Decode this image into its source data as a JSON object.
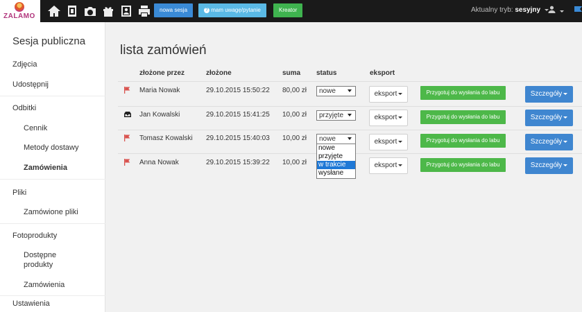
{
  "brand": {
    "logo_text": "ZALAMO"
  },
  "toolbar": {
    "icons": [
      "home-icon",
      "album-icon",
      "camera-icon",
      "gift-icon",
      "portrait-icon",
      "print-icon"
    ],
    "new_session": "nowa sesja",
    "question": "mam uwagę/pytanie",
    "creator": "Kreator",
    "mode_label": "Aktualny tryb:",
    "mode_value": "sesyjny"
  },
  "colors": {
    "topbar": "#1a1a1a",
    "green": "#4db849",
    "blue": "#3f86d0",
    "flag": "#d9534f",
    "highlight": "#1e78d6"
  },
  "sidebar": {
    "title": "Sesja publiczna",
    "items": [
      {
        "label": "Zdjęcia"
      },
      {
        "label": "Udostępnij"
      },
      {
        "label": "Odbitki"
      },
      {
        "label": "Cennik"
      },
      {
        "label": "Metody dostawy"
      },
      {
        "label": "Zamówienia"
      },
      {
        "label": "Pliki"
      },
      {
        "label": "Zamówione pliki"
      },
      {
        "label": "Fotoprodukty"
      },
      {
        "label": "Dostępne"
      },
      {
        "label": "produkty"
      },
      {
        "label": "Zamówienia"
      },
      {
        "label": "Ustawienia"
      }
    ]
  },
  "page": {
    "title": "lista zamówień"
  },
  "table": {
    "columns": [
      "złożone przez",
      "złożone",
      "suma",
      "status",
      "eksport"
    ],
    "export_label": "eksport",
    "prepare_label": "Przygotuj do wysłania do labu",
    "details_label": "Szczegóły",
    "rows": [
      {
        "icon": "flag-icon",
        "name": "Maria Nowak",
        "date": "29.10.2015 15:50:22",
        "sum": "80,00 zł",
        "status": "nowe"
      },
      {
        "icon": "inbox-icon",
        "name": "Jan Kowalski",
        "date": "29.10.2015 15:41:25",
        "sum": "10,00 zł",
        "status": "przyjęte"
      },
      {
        "icon": "flag-icon",
        "name": "Tomasz Kowalski",
        "date": "29.10.2015 15:40:03",
        "sum": "10,00 zł",
        "status": "nowe"
      },
      {
        "icon": "flag-icon",
        "name": "Anna Nowak",
        "date": "29.10.2015 15:39:22",
        "sum": "10,00 zł",
        "status": ""
      }
    ]
  },
  "status_dropdown": {
    "options": [
      "nowe",
      "przyjęte",
      "w trakcie",
      "wysłane"
    ],
    "highlighted": "w trakcie"
  }
}
